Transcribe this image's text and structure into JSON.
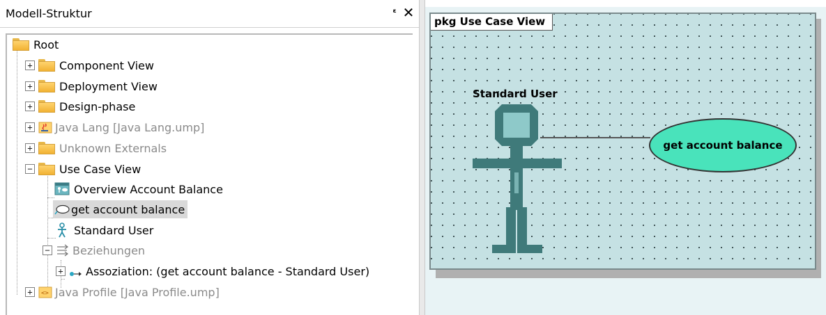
{
  "panel": {
    "title": "Modell-Struktur",
    "pin_glyph": "Ԃ",
    "close_glyph": "✕"
  },
  "tree": {
    "root": "Root",
    "component_view": "Component View",
    "deployment_view": "Deployment View",
    "design_phase": "Design-phase",
    "java_lang": "Java Lang [Java Lang.ump]",
    "unknown_externals": "Unknown Externals",
    "use_case_view": "Use Case View",
    "overview_account_balance": "Overview Account Balance",
    "get_account_balance": "get account balance",
    "standard_user": "Standard User",
    "beziehungen": "Beziehungen",
    "assoziation": "Assoziation:  (get account balance - Standard User)",
    "java_profile": "Java Profile [Java Profile.ump]",
    "expand_plus": "+",
    "expand_minus": "−"
  },
  "diagram": {
    "package_label": "pkg Use Case View",
    "actor_name": "Standard User",
    "use_case_label": "get account balance",
    "colors": {
      "background": "#c5e1e3",
      "actor": "#3f7a7a",
      "actor_head": "#8ec9c9",
      "use_case_fill": "#49e3bb"
    }
  }
}
